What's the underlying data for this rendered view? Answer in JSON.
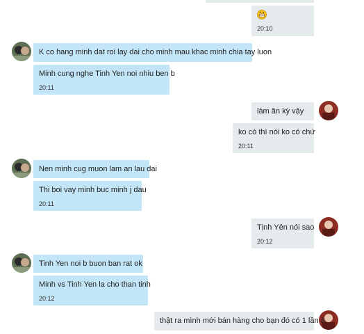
{
  "conversation": {
    "messages": [
      {
        "side": "out",
        "emoji": "grinning-face-icon",
        "time": "20:10"
      },
      {
        "side": "in",
        "text": "K co hang minh dat roi lay dai cho minh mau khac minh chia tay luon"
      },
      {
        "side": "in",
        "text": "Minh cung nghe Tinh Yen noi nhiu ben b",
        "time": "20:11"
      },
      {
        "side": "out",
        "text": "làm ăn kỳ vậy"
      },
      {
        "side": "out",
        "text": "ko có thì nói ko có chứ",
        "time": "20:11"
      },
      {
        "side": "in",
        "text": "Nen minh cug muon lam an lau dai"
      },
      {
        "side": "in",
        "text": "Thi boi vay minh buc minh j dau",
        "time": "20:11"
      },
      {
        "side": "out",
        "text": "Tịnh Yên nói sao",
        "time": "20:12"
      },
      {
        "side": "in",
        "text": "Tinh Yen noi b buon ban rat ok"
      },
      {
        "side": "in",
        "text": "Minh vs Tinh Yen la cho than tinh",
        "time": "20:12"
      },
      {
        "side": "out",
        "text": "thật ra mình mới bán hàng cho bạn đó có 1 lần à"
      }
    ]
  }
}
